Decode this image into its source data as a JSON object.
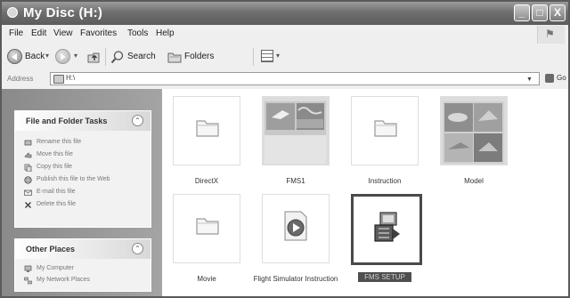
{
  "window": {
    "title": "My Disc (H:)",
    "controls": [
      "_",
      "□",
      "X"
    ]
  },
  "menu": [
    "File",
    "Edit",
    "View",
    "Favorites",
    "Tools",
    "Help"
  ],
  "toolbar": {
    "back_label": "Back",
    "search_label": "Search",
    "folders_label": "Folders"
  },
  "address": {
    "label": "Address",
    "value": "H:\\",
    "go_label": "Go"
  },
  "tasks_panel": {
    "title": "File and Folder Tasks",
    "items": [
      {
        "label": "Rename this file",
        "icon": "rename-icon"
      },
      {
        "label": "Move this file",
        "icon": "move-icon"
      },
      {
        "label": "Copy this file",
        "icon": "copy-icon"
      },
      {
        "label": "Publish this file to the Web",
        "icon": "globe-icon"
      },
      {
        "label": "E-mail this file",
        "icon": "email-icon"
      },
      {
        "label": "Delete this file",
        "icon": "delete-icon"
      }
    ]
  },
  "places_panel": {
    "title": "Other Places",
    "items": [
      {
        "label": "My Computer",
        "icon": "computer-icon"
      },
      {
        "label": "My Network Places",
        "icon": "network-icon"
      }
    ]
  },
  "files": [
    {
      "label": "DirectX",
      "type": "folder"
    },
    {
      "label": "FMS1",
      "type": "folder-thumb"
    },
    {
      "label": "Instruction",
      "type": "folder"
    },
    {
      "label": "Model",
      "type": "folder-thumb"
    },
    {
      "label": "Movie",
      "type": "folder"
    },
    {
      "label": "Flight Simulator Instruction",
      "type": "media"
    },
    {
      "label": "FMS SETUP",
      "type": "setup",
      "selected": true
    }
  ]
}
